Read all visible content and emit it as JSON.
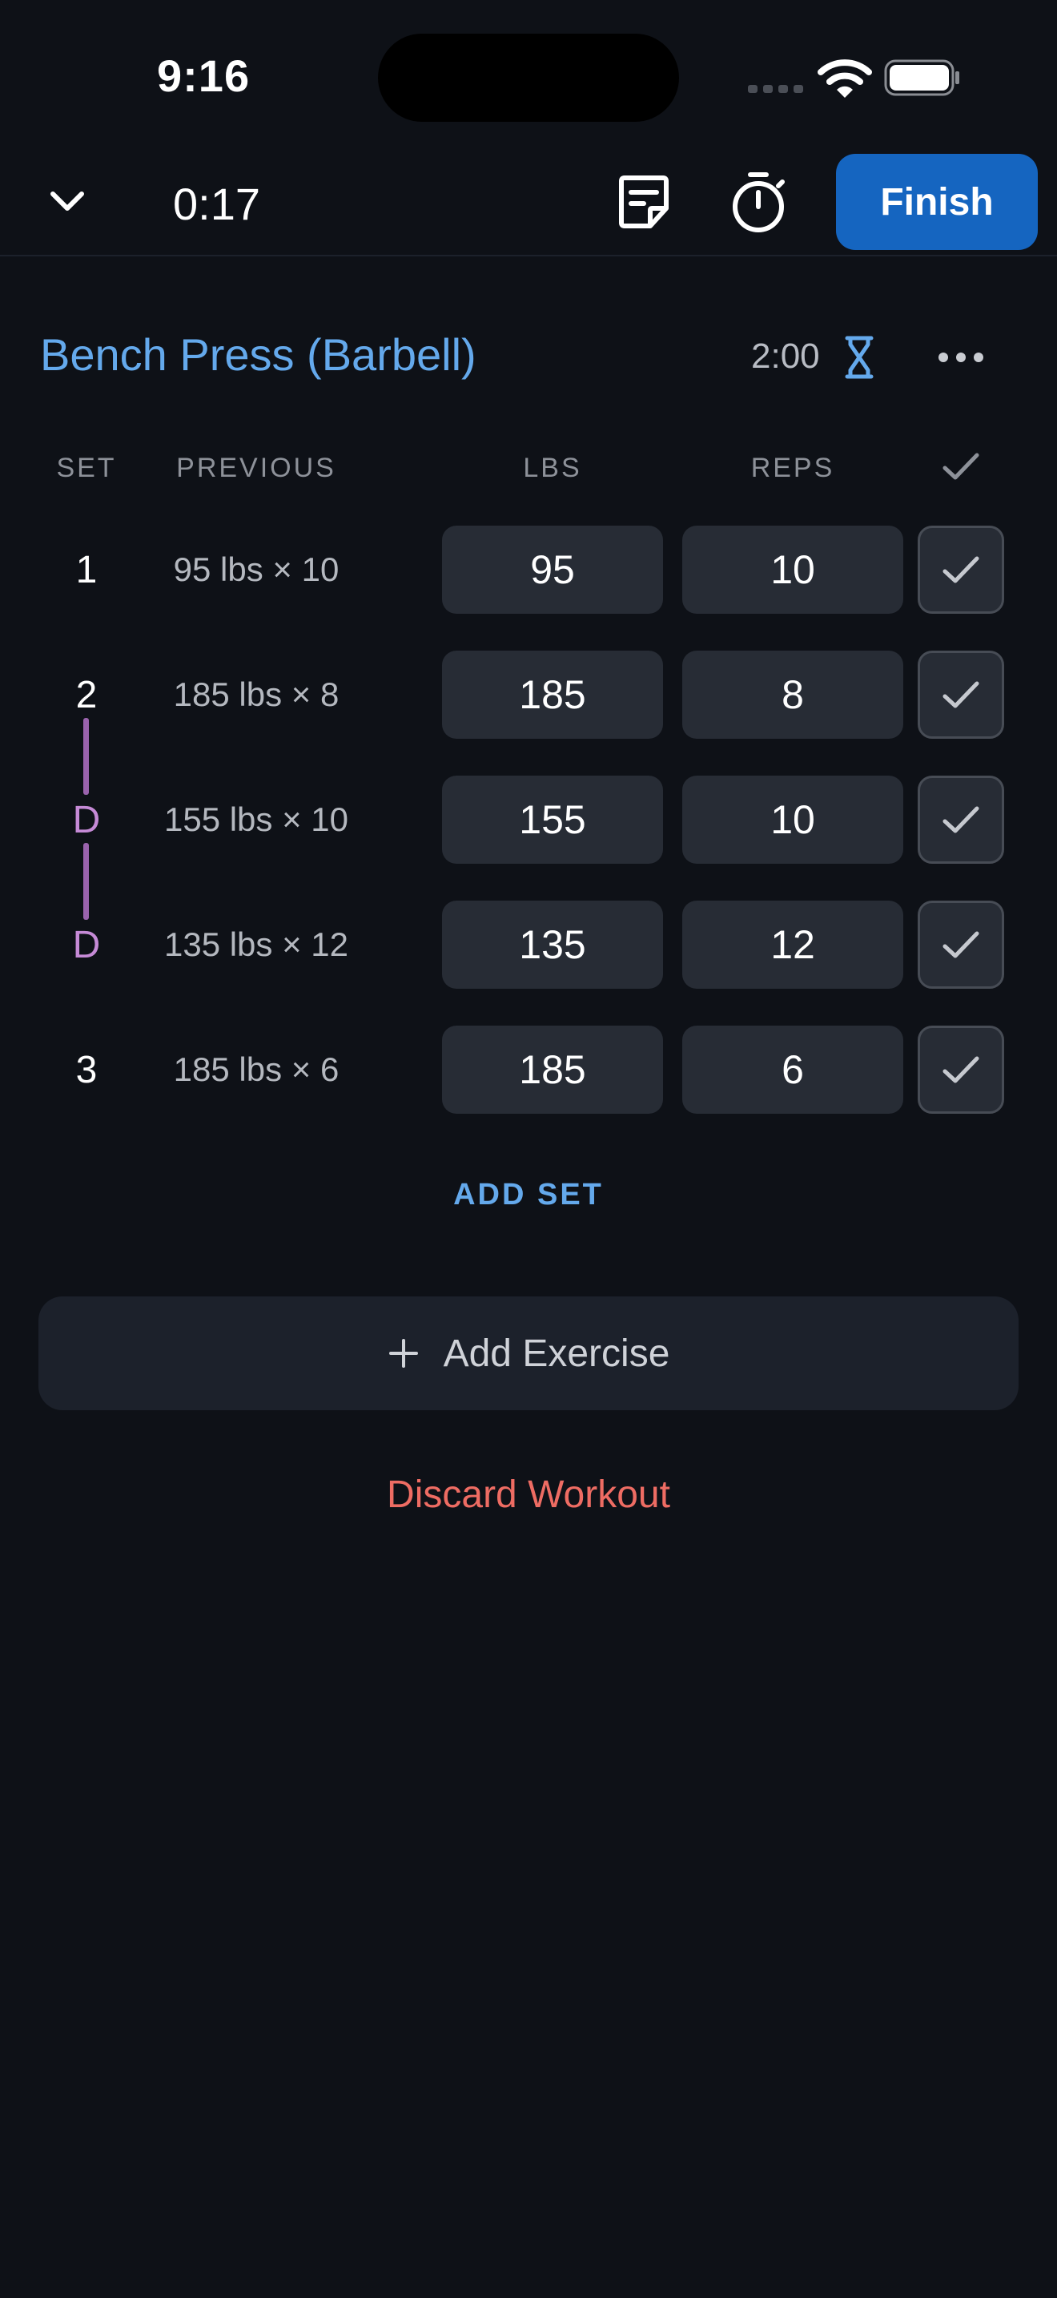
{
  "status_bar": {
    "time": "9:16"
  },
  "header": {
    "elapsed": "0:17",
    "finish_label": "Finish"
  },
  "exercise": {
    "name": "Bench Press (Barbell)",
    "rest_time": "2:00"
  },
  "columns": {
    "set": "SET",
    "previous": "PREVIOUS",
    "lbs": "LBS",
    "reps": "REPS"
  },
  "sets": [
    {
      "set": "1",
      "previous": "95 lbs × 10",
      "lbs": "95",
      "reps": "10",
      "type": "normal"
    },
    {
      "set": "2",
      "previous": "185 lbs × 8",
      "lbs": "185",
      "reps": "8",
      "type": "normal"
    },
    {
      "set": "D",
      "previous": "155 lbs × 10",
      "lbs": "155",
      "reps": "10",
      "type": "drop"
    },
    {
      "set": "D",
      "previous": "135 lbs × 12",
      "lbs": "135",
      "reps": "12",
      "type": "drop"
    },
    {
      "set": "3",
      "previous": "185 lbs × 6",
      "lbs": "185",
      "reps": "6",
      "type": "normal"
    }
  ],
  "add_set_label": "ADD SET",
  "add_exercise_label": "Add Exercise",
  "discard_label": "Discard Workout",
  "colors": {
    "accent": "#64a9ec",
    "finish": "#1565c0",
    "drop_set": "#c58ad6",
    "danger": "#ee6c63",
    "background": "#0e1117"
  }
}
